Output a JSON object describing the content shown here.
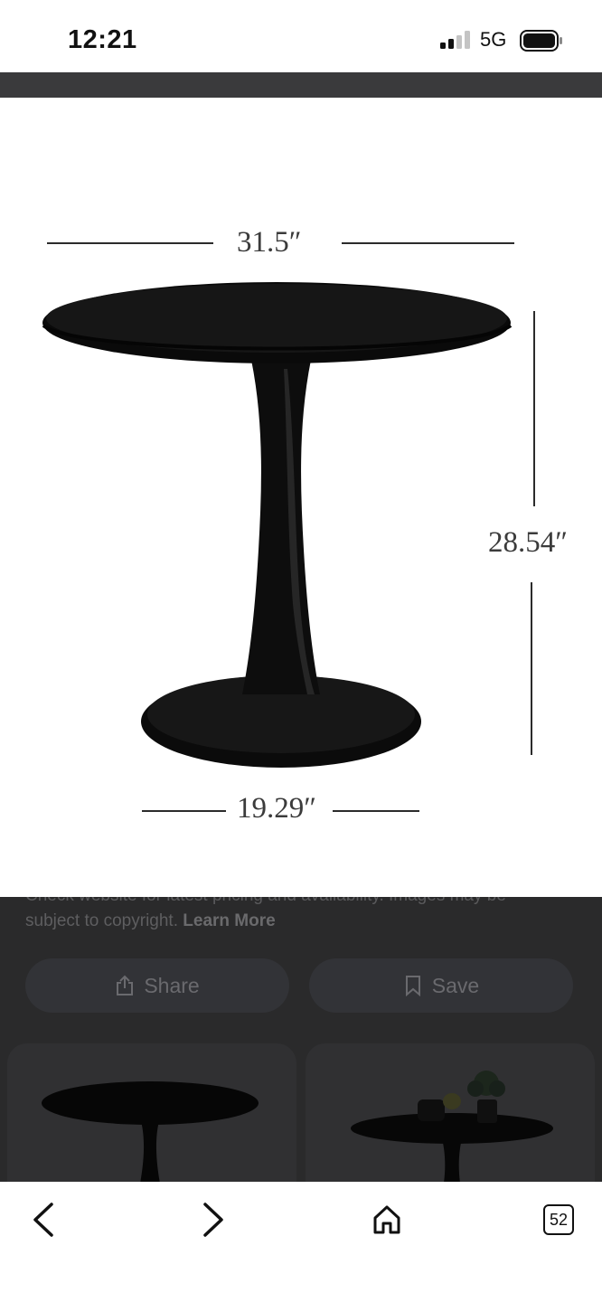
{
  "status_bar": {
    "time": "12:21",
    "network": "5G",
    "signal_bars_active": 2,
    "signal_bars_total": 4
  },
  "image_viewer": {
    "dimensions": {
      "width": "31.5″",
      "height": "28.54″",
      "base": "19.29″"
    }
  },
  "details": {
    "disclaimer_line1": "Check website for latest pricing and availability. Images may be",
    "disclaimer_line2": "subject to copyright.",
    "learn_more": "Learn More",
    "share_label": "Share",
    "save_label": "Save"
  },
  "browser_toolbar": {
    "tab_count": "52"
  },
  "icons": {
    "back": "chevron-left-icon",
    "forward": "chevron-right-icon",
    "home": "home-icon",
    "tabs": "tabs-icon",
    "share": "share-icon",
    "save": "bookmark-icon"
  },
  "colors": {
    "overlay": "#2a2a2b",
    "table": "#0b0b0b"
  }
}
